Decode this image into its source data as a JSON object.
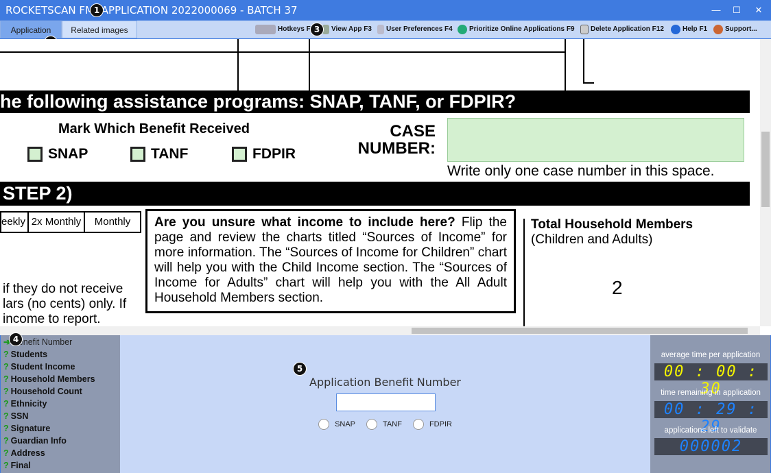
{
  "window": {
    "title": "ROCKETSCAN FM",
    "title_rest": " APPLICATION 2022000069 - BATCH 37",
    "minimize": "—",
    "maximize": "☐",
    "close": "✕"
  },
  "badges": [
    "1",
    "2",
    "3",
    "4",
    "5"
  ],
  "tabs": [
    {
      "label": "Application",
      "active": true
    },
    {
      "label": "Related images",
      "active": false
    }
  ],
  "toolbar": [
    {
      "label": "Hotkeys F",
      "icon": "keyboard-icon"
    },
    {
      "label": "View App F3",
      "icon": "view-icon"
    },
    {
      "label": "User Preferences F4",
      "icon": "preferences-icon"
    },
    {
      "label": "Prioritize Online Applications F9",
      "icon": "globe-icon"
    },
    {
      "label": "Delete Application F12",
      "icon": "trash-icon"
    },
    {
      "label": "Help F1",
      "icon": "help-icon"
    },
    {
      "label": "Support...",
      "icon": "support-icon"
    }
  ],
  "document": {
    "question": "he following assistance programs: SNAP, TANF, or FDPIR?",
    "mark_heading": "Mark Which Benefit Received",
    "benefits": [
      "SNAP",
      "TANF",
      "FDPIR"
    ],
    "case_label_1": "CASE",
    "case_label_2": "NUMBER:",
    "case_note": "Write only one case number in this space.",
    "step": "STEP 2)",
    "freq": [
      "eekly",
      "2x Monthly",
      "Monthly"
    ],
    "unsure_bold": "Are you unsure what income to include here?",
    "unsure_rest": " Flip the page and review the charts titled “Sources of Income” for more information. The “Sources of Income for Children” chart will help you with the Child Income section. The “Sources of Income for Adults” chart will help you with the All Adult Household Members section.",
    "left_text": [
      "if they do not receive",
      "lars (no cents) only. If",
      "income to report."
    ],
    "total_title": "Total Household Members",
    "total_sub": "(Children and Adults)",
    "total_value": "2"
  },
  "steps": [
    {
      "label": "Benefit Number",
      "status": "current"
    },
    {
      "label": "Students",
      "status": "pending"
    },
    {
      "label": "Student Income",
      "status": "pending"
    },
    {
      "label": "Household Members",
      "status": "pending"
    },
    {
      "label": "Household Count",
      "status": "pending"
    },
    {
      "label": "Ethnicity",
      "status": "pending"
    },
    {
      "label": "SSN",
      "status": "pending"
    },
    {
      "label": "Signature",
      "status": "pending"
    },
    {
      "label": "Guardian Info",
      "status": "pending"
    },
    {
      "label": "Address",
      "status": "pending"
    },
    {
      "label": "Final",
      "status": "pending"
    }
  ],
  "form": {
    "title": "Application Benefit Number",
    "value": "",
    "options": [
      "SNAP",
      "TANF",
      "FDPIR"
    ]
  },
  "stats": {
    "avg_label": "average time per application",
    "avg_value": "00 : 00 : 30",
    "remaining_label": "time remaining in application",
    "remaining_value": "00 : 29 : 29",
    "left_label": "applications left to validate",
    "left_value": "000002"
  },
  "colors": {
    "titlebar": "#3f7be0",
    "avg": "#f4f400",
    "remaining": "#1e82ff",
    "case_box": "#d4f0d0"
  }
}
